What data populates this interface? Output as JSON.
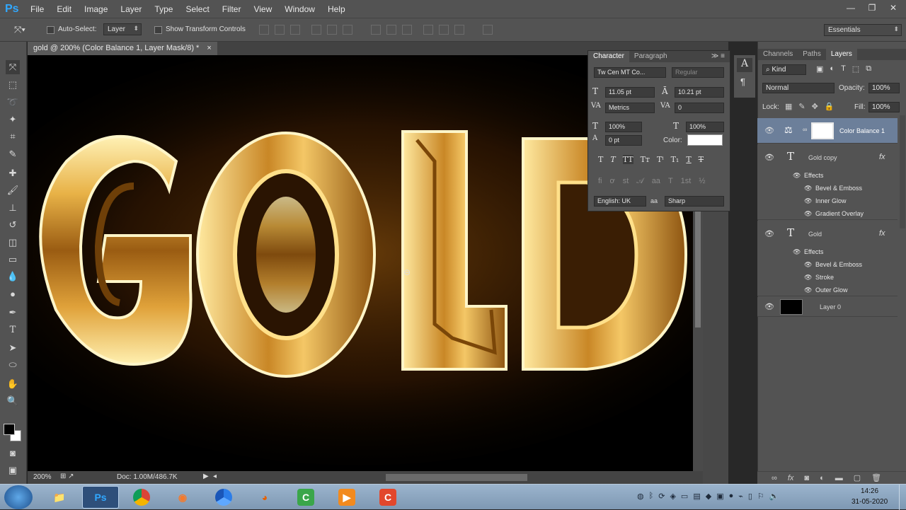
{
  "app": {
    "logo": "Ps"
  },
  "menu": [
    "File",
    "Edit",
    "Image",
    "Layer",
    "Type",
    "Select",
    "Filter",
    "View",
    "Window",
    "Help"
  ],
  "options": {
    "auto_select_label": "Auto-Select:",
    "auto_select_value": "Layer",
    "transform_label": "Show Transform Controls",
    "workspace": "Essentials"
  },
  "document": {
    "tab_title": "gold @ 200% (Color Balance 1, Layer Mask/8) *",
    "close": "×",
    "zoom": "200%",
    "doc_info": "Doc: 1.00M/486.7K",
    "artwork_text": "GOLD"
  },
  "character": {
    "tabs": [
      "Character",
      "Paragraph"
    ],
    "font_family": "Tw Cen MT Co...",
    "font_style": "Regular",
    "font_size": "11.05 pt",
    "leading": "10.21 pt",
    "kerning": "Metrics",
    "tracking": "0",
    "vscale": "100%",
    "hscale": "100%",
    "baseline": "0 pt",
    "color_label": "Color:",
    "color": "#ffffff",
    "language": "English: UK",
    "aa_glyph": "aa",
    "antialias": "Sharp"
  },
  "layers_panel": {
    "tabs": [
      "Channels",
      "Paths",
      "Layers"
    ],
    "filter_kind": "Kind",
    "blend_mode": "Normal",
    "opacity_label": "Opacity:",
    "opacity": "100%",
    "lock_label": "Lock:",
    "fill_label": "Fill:",
    "fill": "100%",
    "layers": [
      {
        "name": "Color Balance 1",
        "type": "adjustment",
        "selected": true
      },
      {
        "name": "Gold copy",
        "type": "text",
        "effects_label": "Effects",
        "effects": [
          "Bevel & Emboss",
          "Inner Glow",
          "Gradient Overlay"
        ]
      },
      {
        "name": "Gold",
        "type": "text",
        "effects_label": "Effects",
        "effects": [
          "Bevel & Emboss",
          "Stroke",
          "Outer Glow"
        ]
      },
      {
        "name": "Layer 0",
        "type": "pixel"
      }
    ]
  },
  "taskbar": {
    "apps": [
      "Windows Explorer",
      "Photoshop",
      "Chrome",
      "Blender",
      "Chrome Canary",
      "Firefox",
      "Camtasia",
      "Media Player",
      "Camtasia Recorder"
    ],
    "ps_label": "Ps",
    "time": "14:26",
    "date": "31-05-2020"
  },
  "colors": {
    "ui_dark": "#535353",
    "canvas_bg": "#000000",
    "gold_light": "#ffe7a0",
    "gold_mid": "#d8a033",
    "gold_dark": "#6e3f08",
    "selected_layer": "#6c7f9a",
    "taskbar": "#8fa8c2"
  }
}
